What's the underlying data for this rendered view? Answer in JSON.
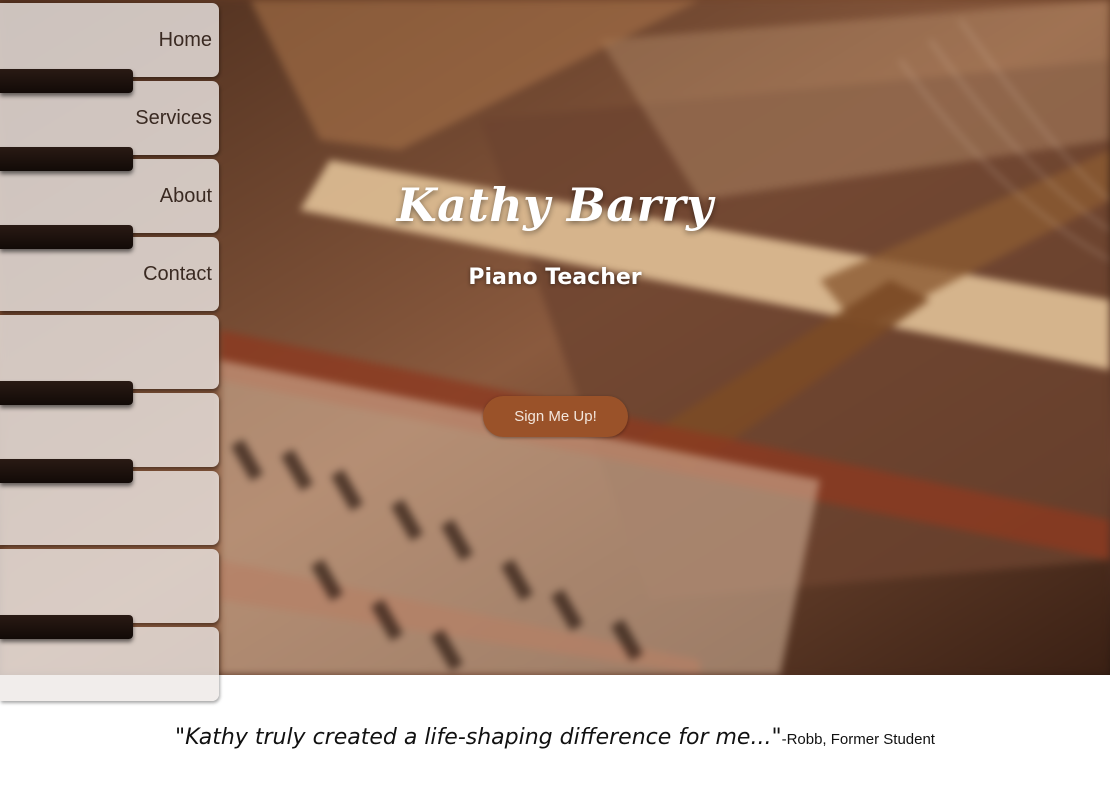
{
  "nav": {
    "items": [
      {
        "label": "Home"
      },
      {
        "label": "Services"
      },
      {
        "label": "About"
      },
      {
        "label": "Contact"
      }
    ]
  },
  "hero": {
    "title": "Kathy Barry",
    "subtitle": "Piano Teacher",
    "cta_label": "Sign Me Up!",
    "background_image": "piano-interior"
  },
  "testimonial": {
    "quote": "\"Kathy truly created a life-shaping difference for me...\"",
    "author": "-Robb, Former Student"
  },
  "colors": {
    "cta_background": "#9a5229",
    "key_white": "#eee8e6",
    "key_black": "#1a100b",
    "text_dark": "#3a2a22"
  }
}
